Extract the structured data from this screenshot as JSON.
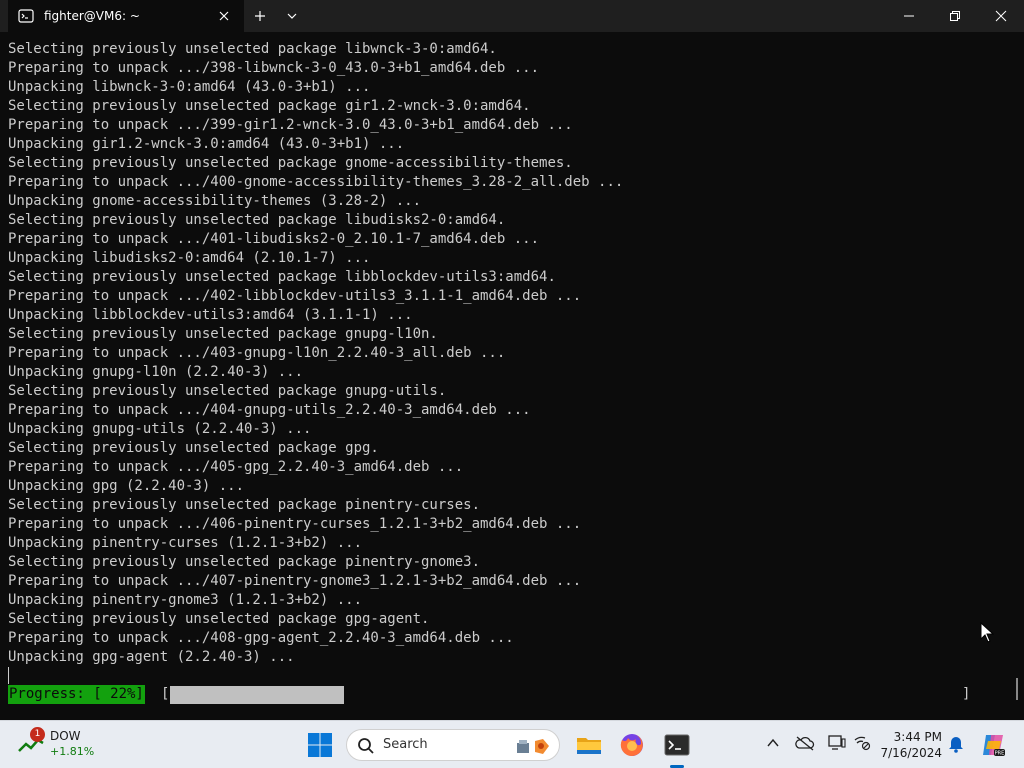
{
  "window": {
    "tab_title": "fighter@VM6: ~",
    "icons": {
      "tab": "terminal-icon",
      "tab_close": "close-icon",
      "new_tab": "plus-icon",
      "dropdown": "chevron-down-icon",
      "minimize": "minimize-icon",
      "restore": "restore-icon",
      "close": "close-icon"
    }
  },
  "terminal": {
    "lines": [
      "Selecting previously unselected package libwnck-3-0:amd64.",
      "Preparing to unpack .../398-libwnck-3-0_43.0-3+b1_amd64.deb ...",
      "Unpacking libwnck-3-0:amd64 (43.0-3+b1) ...",
      "Selecting previously unselected package gir1.2-wnck-3.0:amd64.",
      "Preparing to unpack .../399-gir1.2-wnck-3.0_43.0-3+b1_amd64.deb ...",
      "Unpacking gir1.2-wnck-3.0:amd64 (43.0-3+b1) ...",
      "Selecting previously unselected package gnome-accessibility-themes.",
      "Preparing to unpack .../400-gnome-accessibility-themes_3.28-2_all.deb ...",
      "Unpacking gnome-accessibility-themes (3.28-2) ...",
      "Selecting previously unselected package libudisks2-0:amd64.",
      "Preparing to unpack .../401-libudisks2-0_2.10.1-7_amd64.deb ...",
      "Unpacking libudisks2-0:amd64 (2.10.1-7) ...",
      "Selecting previously unselected package libblockdev-utils3:amd64.",
      "Preparing to unpack .../402-libblockdev-utils3_3.1.1-1_amd64.deb ...",
      "Unpacking libblockdev-utils3:amd64 (3.1.1-1) ...",
      "Selecting previously unselected package gnupg-l10n.",
      "Preparing to unpack .../403-gnupg-l10n_2.2.40-3_all.deb ...",
      "Unpacking gnupg-l10n (2.2.40-3) ...",
      "Selecting previously unselected package gnupg-utils.",
      "Preparing to unpack .../404-gnupg-utils_2.2.40-3_amd64.deb ...",
      "Unpacking gnupg-utils (2.2.40-3) ...",
      "Selecting previously unselected package gpg.",
      "Preparing to unpack .../405-gpg_2.2.40-3_amd64.deb ...",
      "Unpacking gpg (2.2.40-3) ...",
      "Selecting previously unselected package pinentry-curses.",
      "Preparing to unpack .../406-pinentry-curses_1.2.1-3+b2_amd64.deb ...",
      "Unpacking pinentry-curses (1.2.1-3+b2) ...",
      "Selecting previously unselected package pinentry-gnome3.",
      "Preparing to unpack .../407-pinentry-gnome3_1.2.1-3+b2_amd64.deb ...",
      "Unpacking pinentry-gnome3 (1.2.1-3+b2) ...",
      "Selecting previously unselected package gpg-agent.",
      "Preparing to unpack .../408-gpg-agent_2.2.40-3_amd64.deb ...",
      "Unpacking gpg-agent (2.2.40-3) ..."
    ],
    "progress": {
      "label": "Progress: [ 22%]",
      "bracket_open": "[",
      "bracket_close": "]",
      "fraction": 0.22
    },
    "colors": {
      "background": "#0c0c0c",
      "text": "#cccccc",
      "progress_label_bg": "#13a10e"
    }
  },
  "taskbar": {
    "widget": {
      "badge": "1",
      "name": "DOW",
      "change": "+1.81%",
      "icon": "stock-chart-icon"
    },
    "search_label": "Search",
    "apps": [
      "windows-start-icon",
      "file-explorer-icon",
      "firefox-icon",
      "terminal-icon"
    ],
    "tray": [
      "chevron-up-icon",
      "onedrive-offline-icon",
      "display-icon",
      "network-icon",
      "notification-bell-icon",
      "copilot-icon"
    ],
    "clock": {
      "time": "3:44 PM",
      "date": "7/16/2024"
    }
  }
}
